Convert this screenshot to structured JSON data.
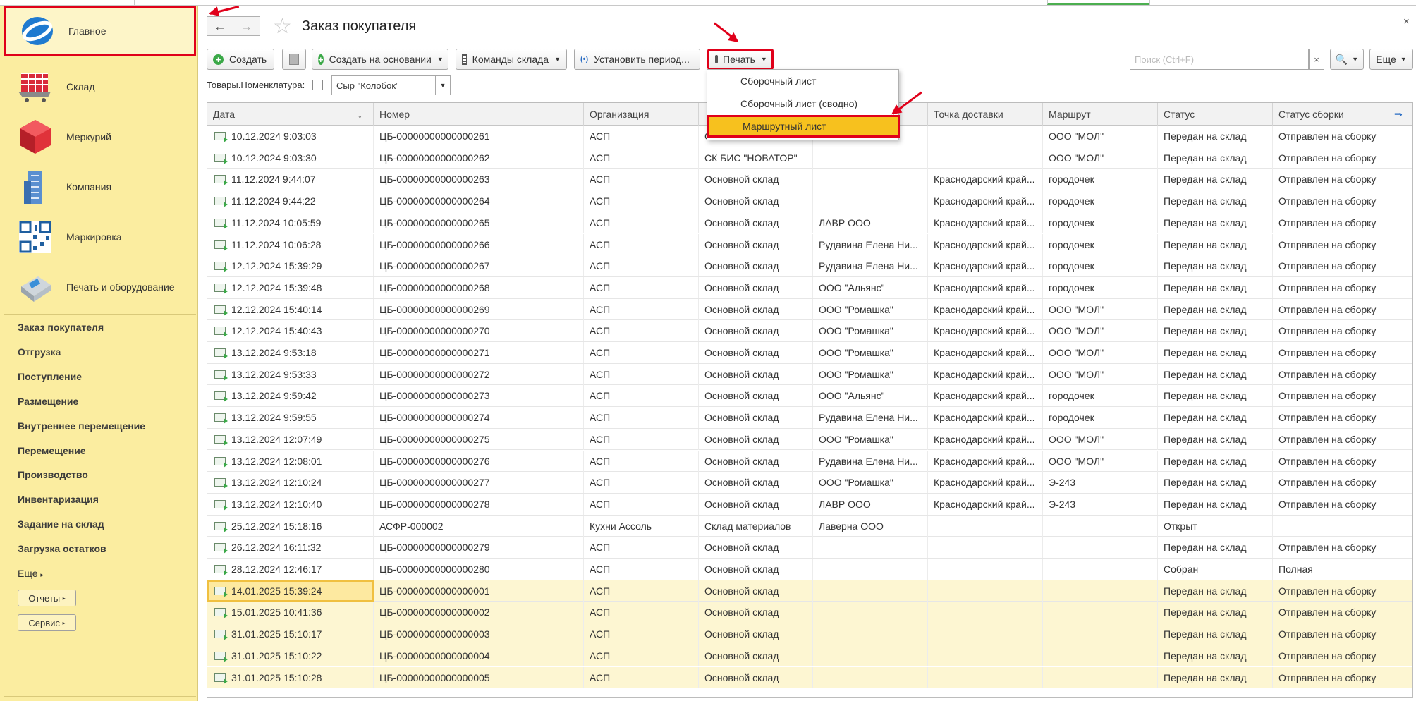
{
  "sidebar": {
    "sections": [
      {
        "label": "Главное",
        "icon": "main-logo-icon"
      },
      {
        "label": "Склад",
        "icon": "warehouse-cart-icon"
      },
      {
        "label": "Меркурий",
        "icon": "mercury-cube-icon"
      },
      {
        "label": "Компания",
        "icon": "building-icon"
      },
      {
        "label": "Маркировка",
        "icon": "qr-code-icon"
      },
      {
        "label": "Печать и оборудование",
        "icon": "printer-icon"
      }
    ],
    "links": [
      "Заказ покупателя",
      "Отгрузка",
      "Поступление",
      "Размещение",
      "Внутреннее перемещение",
      "Перемещение",
      "Производство",
      "Инвентаризация",
      "Задание на склад",
      "Загрузка остатков"
    ],
    "more": "Еще",
    "buttons": [
      "Отчеты",
      "Сервис"
    ]
  },
  "header": {
    "title": "Заказ покупателя",
    "back": "←",
    "forward": "→",
    "close": "×"
  },
  "toolbar": {
    "create": "Создать",
    "create_based": "Создать на основании",
    "warehouse_commands": "Команды склада",
    "set_period": "Установить период...",
    "print": "Печать",
    "search_placeholder": "Поиск (Ctrl+F)",
    "search_clear": "×",
    "more": "Еще"
  },
  "filter": {
    "label": "Товары.Номенклатура:",
    "value": "Сыр \"Колобок\""
  },
  "print_menu": [
    "Сборочный лист",
    "Сборочный лист (сводно)",
    "Маршрутный лист"
  ],
  "table": {
    "columns": [
      "Дата",
      "Номер",
      "Организация",
      "",
      "",
      "Точка доставки",
      "Маршрут",
      "Статус",
      "Статус сборки"
    ],
    "rows": [
      [
        "10.12.2024 9:03:03",
        "ЦБ-00000000000000261",
        "АСП",
        "СК БИС \"НОВАТОР\"",
        "",
        "",
        "ООО \"МОЛ\"",
        "Передан на склад",
        "Отправлен на сборку"
      ],
      [
        "10.12.2024 9:03:30",
        "ЦБ-00000000000000262",
        "АСП",
        "СК БИС \"НОВАТОР\"",
        "",
        "",
        "ООО \"МОЛ\"",
        "Передан на склад",
        "Отправлен на сборку"
      ],
      [
        "11.12.2024 9:44:07",
        "ЦБ-00000000000000263",
        "АСП",
        "Основной склад",
        "",
        "Краснодарский край...",
        "городочек",
        "Передан на склад",
        "Отправлен на сборку"
      ],
      [
        "11.12.2024 9:44:22",
        "ЦБ-00000000000000264",
        "АСП",
        "Основной склад",
        "",
        "Краснодарский край...",
        "городочек",
        "Передан на склад",
        "Отправлен на сборку"
      ],
      [
        "11.12.2024 10:05:59",
        "ЦБ-00000000000000265",
        "АСП",
        "Основной склад",
        "ЛАВР ООО",
        "Краснодарский край...",
        "городочек",
        "Передан на склад",
        "Отправлен на сборку"
      ],
      [
        "11.12.2024 10:06:28",
        "ЦБ-00000000000000266",
        "АСП",
        "Основной склад",
        "Рудавина Елена Ни...",
        "Краснодарский край...",
        "городочек",
        "Передан на склад",
        "Отправлен на сборку"
      ],
      [
        "12.12.2024 15:39:29",
        "ЦБ-00000000000000267",
        "АСП",
        "Основной склад",
        "Рудавина Елена Ни...",
        "Краснодарский край...",
        "городочек",
        "Передан на склад",
        "Отправлен на сборку"
      ],
      [
        "12.12.2024 15:39:48",
        "ЦБ-00000000000000268",
        "АСП",
        "Основной склад",
        "ООО \"Альянс\"",
        "Краснодарский край...",
        "городочек",
        "Передан на склад",
        "Отправлен на сборку"
      ],
      [
        "12.12.2024 15:40:14",
        "ЦБ-00000000000000269",
        "АСП",
        "Основной склад",
        "ООО \"Ромашка\"",
        "Краснодарский край...",
        "ООО \"МОЛ\"",
        "Передан на склад",
        "Отправлен на сборку"
      ],
      [
        "12.12.2024 15:40:43",
        "ЦБ-00000000000000270",
        "АСП",
        "Основной склад",
        "ООО \"Ромашка\"",
        "Краснодарский край...",
        "ООО \"МОЛ\"",
        "Передан на склад",
        "Отправлен на сборку"
      ],
      [
        "13.12.2024 9:53:18",
        "ЦБ-00000000000000271",
        "АСП",
        "Основной склад",
        "ООО \"Ромашка\"",
        "Краснодарский край...",
        "ООО \"МОЛ\"",
        "Передан на склад",
        "Отправлен на сборку"
      ],
      [
        "13.12.2024 9:53:33",
        "ЦБ-00000000000000272",
        "АСП",
        "Основной склад",
        "ООО \"Ромашка\"",
        "Краснодарский край...",
        "ООО \"МОЛ\"",
        "Передан на склад",
        "Отправлен на сборку"
      ],
      [
        "13.12.2024 9:59:42",
        "ЦБ-00000000000000273",
        "АСП",
        "Основной склад",
        "ООО \"Альянс\"",
        "Краснодарский край...",
        "городочек",
        "Передан на склад",
        "Отправлен на сборку"
      ],
      [
        "13.12.2024 9:59:55",
        "ЦБ-00000000000000274",
        "АСП",
        "Основной склад",
        "Рудавина Елена Ни...",
        "Краснодарский край...",
        "городочек",
        "Передан на склад",
        "Отправлен на сборку"
      ],
      [
        "13.12.2024 12:07:49",
        "ЦБ-00000000000000275",
        "АСП",
        "Основной склад",
        "ООО \"Ромашка\"",
        "Краснодарский край...",
        "ООО \"МОЛ\"",
        "Передан на склад",
        "Отправлен на сборку"
      ],
      [
        "13.12.2024 12:08:01",
        "ЦБ-00000000000000276",
        "АСП",
        "Основной склад",
        "Рудавина Елена Ни...",
        "Краснодарский край...",
        "ООО \"МОЛ\"",
        "Передан на склад",
        "Отправлен на сборку"
      ],
      [
        "13.12.2024 12:10:24",
        "ЦБ-00000000000000277",
        "АСП",
        "Основной склад",
        "ООО \"Ромашка\"",
        "Краснодарский край...",
        "Э-243",
        "Передан на склад",
        "Отправлен на сборку"
      ],
      [
        "13.12.2024 12:10:40",
        "ЦБ-00000000000000278",
        "АСП",
        "Основной склад",
        "ЛАВР ООО",
        "Краснодарский край...",
        "Э-243",
        "Передан на склад",
        "Отправлен на сборку"
      ],
      [
        "25.12.2024 15:18:16",
        "АСФР-000002",
        "Кухни Ассоль",
        "Склад материалов",
        "Лаверна ООО",
        "",
        "",
        "Открыт",
        ""
      ],
      [
        "26.12.2024 16:11:32",
        "ЦБ-00000000000000279",
        "АСП",
        "Основной склад",
        "",
        "",
        "",
        "Передан на склад",
        "Отправлен на сборку"
      ],
      [
        "28.12.2024 12:46:17",
        "ЦБ-00000000000000280",
        "АСП",
        "Основной склад",
        "",
        "",
        "",
        "Собран",
        "Полная"
      ],
      [
        "14.01.2025 15:39:24",
        "ЦБ-00000000000000001",
        "АСП",
        "Основной склад",
        "",
        "",
        "",
        "Передан на склад",
        "Отправлен на сборку"
      ],
      [
        "15.01.2025 10:41:36",
        "ЦБ-00000000000000002",
        "АСП",
        "Основной склад",
        "",
        "",
        "",
        "Передан на склад",
        "Отправлен на сборку"
      ],
      [
        "31.01.2025 15:10:17",
        "ЦБ-00000000000000003",
        "АСП",
        "Основной склад",
        "",
        "",
        "",
        "Передан на склад",
        "Отправлен на сборку"
      ],
      [
        "31.01.2025 15:10:22",
        "ЦБ-00000000000000004",
        "АСП",
        "Основной склад",
        "",
        "",
        "",
        "Передан на склад",
        "Отправлен на сборку"
      ],
      [
        "31.01.2025 15:10:28",
        "ЦБ-00000000000000005",
        "АСП",
        "Основной склад",
        "",
        "",
        "",
        "Передан на склад",
        "Отправлен на сборку"
      ]
    ]
  },
  "colors": {
    "sidebar_bg": "#fbeda0",
    "highlight": "#e0001a",
    "menu_hot": "#f7c11e",
    "row_highlight": "#fdf6d2"
  }
}
